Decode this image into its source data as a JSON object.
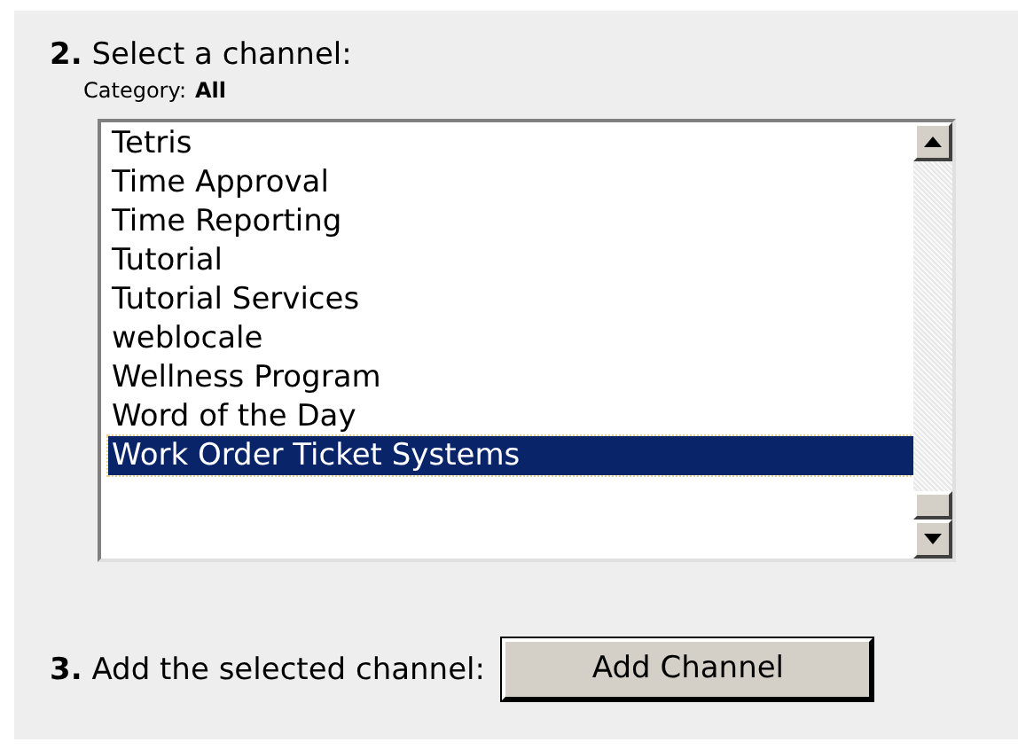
{
  "step2": {
    "number": "2.",
    "label": "Select a channel:",
    "category_label": "Category:",
    "category_value": "All"
  },
  "channels": [
    {
      "name": "Tetris",
      "selected": false
    },
    {
      "name": "Time Approval",
      "selected": false
    },
    {
      "name": "Time Reporting",
      "selected": false
    },
    {
      "name": "Tutorial",
      "selected": false
    },
    {
      "name": "Tutorial Services",
      "selected": false
    },
    {
      "name": "weblocale",
      "selected": false
    },
    {
      "name": "Wellness Program",
      "selected": false
    },
    {
      "name": "Word of the Day",
      "selected": false
    },
    {
      "name": "Work Order Ticket Systems",
      "selected": true
    }
  ],
  "step3": {
    "number": "3.",
    "label": "Add the selected channel:",
    "button": "Add Channel"
  }
}
